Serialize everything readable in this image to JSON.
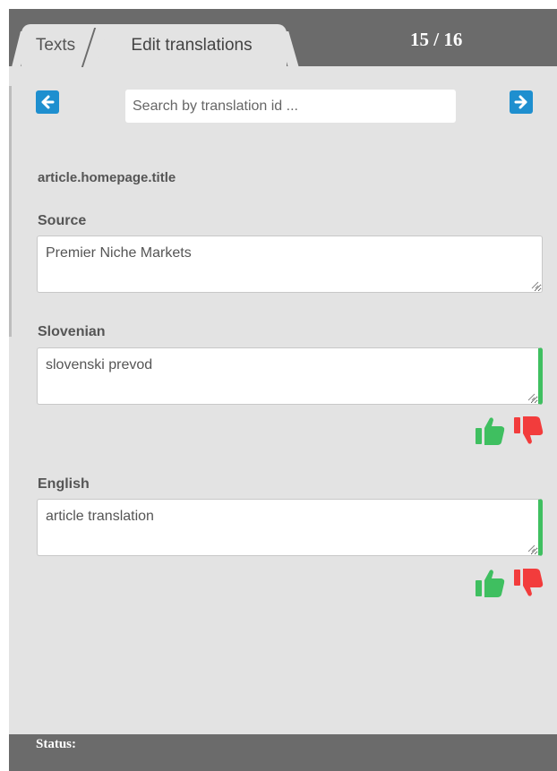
{
  "tabs": [
    {
      "label": "Texts"
    },
    {
      "label": "Edit translations"
    }
  ],
  "counter": "15 / 16",
  "search": {
    "placeholder": "Search by translation id ..."
  },
  "translation_id": "article.homepage.title",
  "fields": [
    {
      "label": "Source",
      "value": "Premier Niche Markets"
    },
    {
      "label": "Slovenian",
      "value": "slovenski prevod"
    },
    {
      "label": "English",
      "value": "article translation"
    }
  ],
  "status": {
    "label": "Status:"
  },
  "colors": {
    "accent": "#1e8fcf",
    "approve": "#3fbf60",
    "reject": "#f23c3c",
    "bar": "#6b6b6b",
    "panel": "#e3e3e3"
  },
  "icons": {
    "prev": "arrow-left-icon",
    "next": "arrow-right-icon",
    "approve": "thumbs-up-icon",
    "reject": "thumbs-down-icon"
  }
}
